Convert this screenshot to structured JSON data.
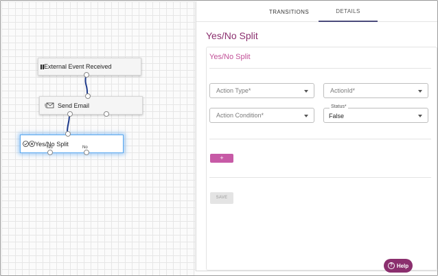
{
  "canvas": {
    "nodes": [
      {
        "label": "External Event Received",
        "icon": "pause-icon"
      },
      {
        "label": "Send Email",
        "icon": "envelope-send-icon"
      },
      {
        "label": "Yes/No Split",
        "icon": "check-x-icon",
        "ports": [
          "Yes",
          "No"
        ]
      }
    ]
  },
  "panel": {
    "tabs": [
      "TRANSITIONS",
      "DETAILS"
    ],
    "active_tab": "DETAILS",
    "title": "Yes/No Split",
    "card_title": "Yes/No Split",
    "fields": {
      "action_type": {
        "placeholder": "Action Type*"
      },
      "action_id": {
        "placeholder": "ActionId*"
      },
      "action_condition": {
        "placeholder": "Action Condition*"
      },
      "status": {
        "label": "Status*",
        "value": "False"
      }
    },
    "add_label": "+",
    "save_label": "SAVE"
  },
  "help": {
    "label": "Help"
  },
  "colors": {
    "brand": "#8b2f6e",
    "accent": "#c75aa6",
    "selection": "#5aa8f0"
  }
}
